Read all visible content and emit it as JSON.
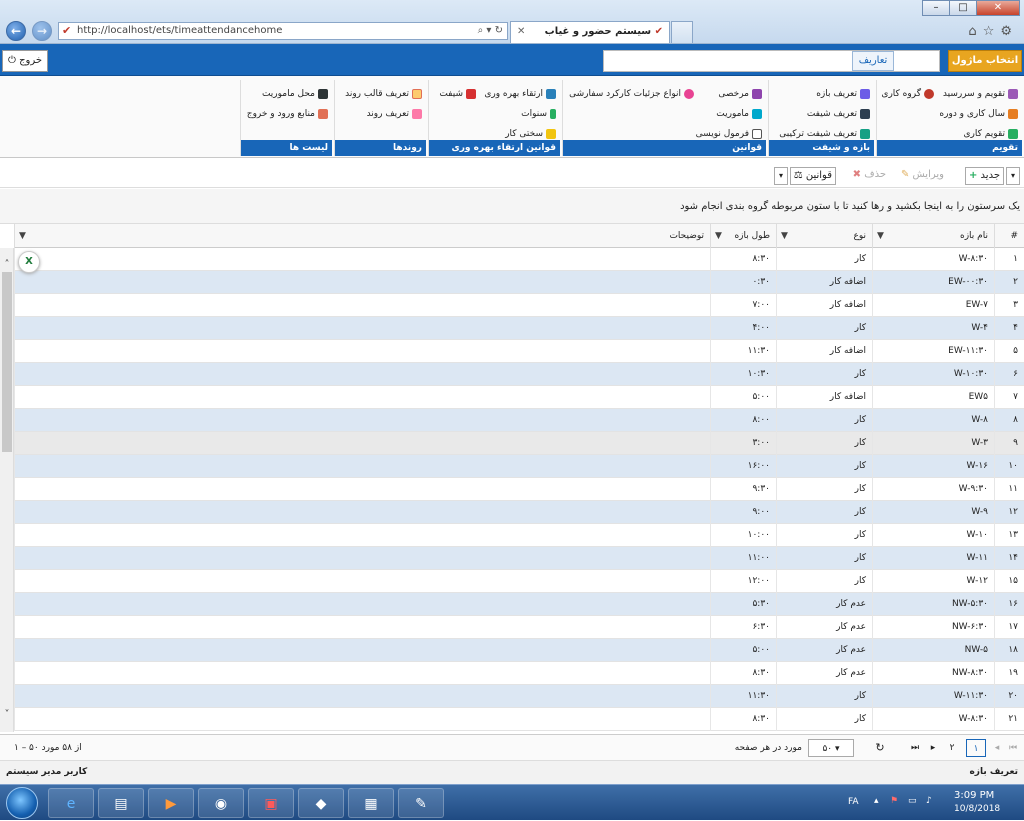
{
  "browser": {
    "url": "http://localhost/ets/timeattendancehome",
    "tab_title": "سیستم حضور و غیاب",
    "search_glyph": "⌕ ▾ ↻"
  },
  "topbar": {
    "module_button": "انتخاب ماژول ▾",
    "definitions_label": "تعاریف",
    "logout_label": "خروج"
  },
  "ribbon": {
    "groups": [
      {
        "caption": "تقویم",
        "items": [
          "تقویم و سررسید",
          "گروه کاری",
          "سال کاری و دوره",
          "تقویم کاری"
        ]
      },
      {
        "caption": "بازه و شیفت",
        "items": [
          "تعریف بازه",
          "تعریف شیفت",
          "تعریف شیفت ترکیبی"
        ]
      },
      {
        "caption": "قوانین",
        "items": [
          "مرخصی",
          "انواع جزئیات کارکرد سفارشی",
          "ماموریت",
          "فرمول نویسی"
        ]
      },
      {
        "caption": "قوانین ارتقاء بهره وری",
        "items": [
          "ارتقاء بهره وری",
          "شیفت",
          "سنوات",
          "سختی کار"
        ]
      },
      {
        "caption": "روندها",
        "items": [
          "تعریف قالب روند",
          "تعریف روند"
        ]
      },
      {
        "caption": "لیست ها",
        "items": [
          "محل ماموریت",
          "منابع ورود و خروج"
        ]
      }
    ]
  },
  "toolbar": {
    "new_label": "جدید",
    "edit_label": "ویرایش",
    "delete_label": "حذف",
    "rules_label": "قوانین"
  },
  "grid": {
    "group_hint": "یک سرستون را به اینجا بکشید و رها کنید تا با ستون مربوطه گروه بندی انجام شود",
    "headers": {
      "num": "#",
      "name": "نام بازه",
      "type": "نوع",
      "length": "طول بازه",
      "desc": "توضیحات"
    },
    "rows": [
      {
        "n": "۱",
        "name": "W-۸:۳۰",
        "type": "کار",
        "len": "۸:۳۰",
        "desc": ""
      },
      {
        "n": "۲",
        "name": "EW-۰۰:۳۰",
        "type": "اضافه کار",
        "len": "۰:۳۰",
        "desc": ""
      },
      {
        "n": "۳",
        "name": "EW-۷",
        "type": "اضافه کار",
        "len": "۷:۰۰",
        "desc": ""
      },
      {
        "n": "۴",
        "name": "W-۴",
        "type": "کار",
        "len": "۴:۰۰",
        "desc": ""
      },
      {
        "n": "۵",
        "name": "EW-۱۱:۳۰",
        "type": "اضافه کار",
        "len": "۱۱:۳۰",
        "desc": ""
      },
      {
        "n": "۶",
        "name": "W-۱۰:۳۰",
        "type": "کار",
        "len": "۱۰:۳۰",
        "desc": ""
      },
      {
        "n": "۷",
        "name": "EW۵",
        "type": "اضافه کار",
        "len": "۵:۰۰",
        "desc": ""
      },
      {
        "n": "۸",
        "name": "W-۸",
        "type": "کار",
        "len": "۸:۰۰",
        "desc": ""
      },
      {
        "n": "۹",
        "name": "W-۳",
        "type": "کار",
        "len": "۳:۰۰",
        "desc": ""
      },
      {
        "n": "۱۰",
        "name": "W-۱۶",
        "type": "کار",
        "len": "۱۶:۰۰",
        "desc": ""
      },
      {
        "n": "۱۱",
        "name": "W-۹:۳۰",
        "type": "کار",
        "len": "۹:۳۰",
        "desc": ""
      },
      {
        "n": "۱۲",
        "name": "W-۹",
        "type": "کار",
        "len": "۹:۰۰",
        "desc": ""
      },
      {
        "n": "۱۳",
        "name": "W-۱۰",
        "type": "کار",
        "len": "۱۰:۰۰",
        "desc": ""
      },
      {
        "n": "۱۴",
        "name": "W-۱۱",
        "type": "کار",
        "len": "۱۱:۰۰",
        "desc": ""
      },
      {
        "n": "۱۵",
        "name": "W-۱۲",
        "type": "کار",
        "len": "۱۲:۰۰",
        "desc": ""
      },
      {
        "n": "۱۶",
        "name": "NW-۵:۳۰",
        "type": "عدم کار",
        "len": "۵:۳۰",
        "desc": ""
      },
      {
        "n": "۱۷",
        "name": "NW-۶:۳۰",
        "type": "عدم کار",
        "len": "۶:۳۰",
        "desc": ""
      },
      {
        "n": "۱۸",
        "name": "NW-۵",
        "type": "عدم کار",
        "len": "۵:۰۰",
        "desc": ""
      },
      {
        "n": "۱۹",
        "name": "NW-۸:۳۰",
        "type": "عدم کار",
        "len": "۸:۳۰",
        "desc": ""
      },
      {
        "n": "۲۰",
        "name": "W-۱۱:۳۰",
        "type": "کار",
        "len": "۱۱:۳۰",
        "desc": ""
      },
      {
        "n": "۲۱",
        "name": "W-۸:۳۰",
        "type": "کار",
        "len": "۸:۳۰",
        "desc": ""
      }
    ]
  },
  "pager": {
    "pages": [
      "۱",
      "۲"
    ],
    "page_size": "۵۰",
    "per_page_label": "مورد در هر صفحه",
    "summary": "۱ – ۵۰ از ۵۸ مورد"
  },
  "status": {
    "left": "کاربر مدیر سیستم",
    "right": "تعریف بازه"
  },
  "taskbar": {
    "lang": "FA",
    "time": "3:09 PM",
    "date": "10/8/2018"
  },
  "colors": {
    "brand_blue": "#1866b8",
    "module_orange": "#e8a520",
    "row_alt": "#dce7f3"
  }
}
